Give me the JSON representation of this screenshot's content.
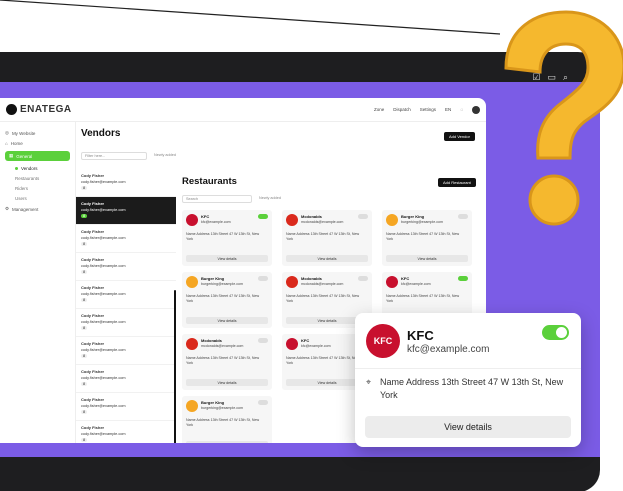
{
  "window": {
    "brand": "ENATEGA",
    "top_nav": [
      "Zone",
      "Dispatch",
      "Settings",
      "EN"
    ]
  },
  "sidebar": {
    "items": [
      {
        "label": "My Website"
      },
      {
        "label": "Home"
      },
      {
        "label": "General",
        "active": true
      },
      {
        "label": "Vendors",
        "sub": true,
        "selected": true
      },
      {
        "label": "Restaurants",
        "sub": true
      },
      {
        "label": "Riders",
        "sub": true
      },
      {
        "label": "Users",
        "sub": true
      },
      {
        "label": "Management"
      }
    ]
  },
  "vendors": {
    "title": "Vendors",
    "add_button": "Add Vendor",
    "filter_placeholder": "Filter here...",
    "sort_label": "Newly added",
    "items": [
      {
        "name": "Cody Fisher",
        "email": "cody.fisher@example.com",
        "count": "8"
      },
      {
        "name": "Cody Fisher",
        "email": "cody.fisher@example.com",
        "count": "8",
        "selected": true
      },
      {
        "name": "Cody Fisher",
        "email": "cody.fisher@example.com",
        "count": "8"
      },
      {
        "name": "Cody Fisher",
        "email": "cody.fisher@example.com",
        "count": "8"
      },
      {
        "name": "Cody Fisher",
        "email": "cody.fisher@example.com",
        "count": "8"
      },
      {
        "name": "Cody Fisher",
        "email": "cody.fisher@example.com",
        "count": "8"
      },
      {
        "name": "Cody Fisher",
        "email": "cody.fisher@example.com",
        "count": "8"
      },
      {
        "name": "Cody Fisher",
        "email": "cody.fisher@example.com",
        "count": "8"
      },
      {
        "name": "Cody Fisher",
        "email": "cody.fisher@example.com",
        "count": "8"
      },
      {
        "name": "Cody Fisher",
        "email": "cody.fisher@example.com",
        "count": "8"
      }
    ]
  },
  "restaurants": {
    "title": "Restaurants",
    "add_button": "Add Restaurant",
    "filter_placeholder": "Search",
    "sort_label": "Newly added",
    "view_label": "View details",
    "cards": [
      {
        "name": "KFC",
        "email": "kfc@example.com",
        "address": "Name Address 13th Street 47 W 13th St, New York",
        "brand": "kfc",
        "on": true
      },
      {
        "name": "Mcdonalds",
        "email": "mcdonalds@example.com",
        "address": "Name Address 13th Street 47 W 13th St, New York",
        "brand": "mcd",
        "on": false
      },
      {
        "name": "Burger King",
        "email": "burgerking@example.com",
        "address": "Name Address 13th Street 47 W 13th St, New York",
        "brand": "bk",
        "on": false
      },
      {
        "name": "Burger King",
        "email": "burgerking@example.com",
        "address": "Name Address 13th Street 47 W 13th St, New York",
        "brand": "bk",
        "on": false
      },
      {
        "name": "Mcdonalds",
        "email": "mcdonalds@example.com",
        "address": "Name Address 13th Street 47 W 13th St, New York",
        "brand": "mcd",
        "on": false
      },
      {
        "name": "KFC",
        "email": "kfc@example.com",
        "address": "Name Address 13th Street 47 W 13th St, New York",
        "brand": "kfc",
        "on": true
      },
      {
        "name": "Mcdonalds",
        "email": "mcdonalds@example.com",
        "address": "Name Address 13th Street 47 W 13th St, New York",
        "brand": "mcd",
        "on": false
      },
      {
        "name": "KFC",
        "email": "kfc@example.com",
        "address": "Name Address 13th Street 47 W 13th St, New York",
        "brand": "kfc",
        "on": false
      },
      {
        "name": "KFC",
        "email": "kfc@example.com",
        "address": "Name Address 13th Street 47 W 13th St, New York",
        "brand": "kfc",
        "on": true
      },
      {
        "name": "Burger King",
        "email": "burgerking@example.com",
        "address": "Name Address 13th Street 47 W 13th St, New York",
        "brand": "bk",
        "on": false
      }
    ]
  },
  "popup": {
    "logo_text": "KFC",
    "name": "KFC",
    "email": "kfc@example.com",
    "address": "Name Address 13th Street 47 W 13th St, New York",
    "button": "View details",
    "toggle_on": true
  },
  "colors": {
    "accent_green": "#5bd03b",
    "background_purple": "#7b5ce6",
    "question_yellow": "#f5b82e"
  }
}
